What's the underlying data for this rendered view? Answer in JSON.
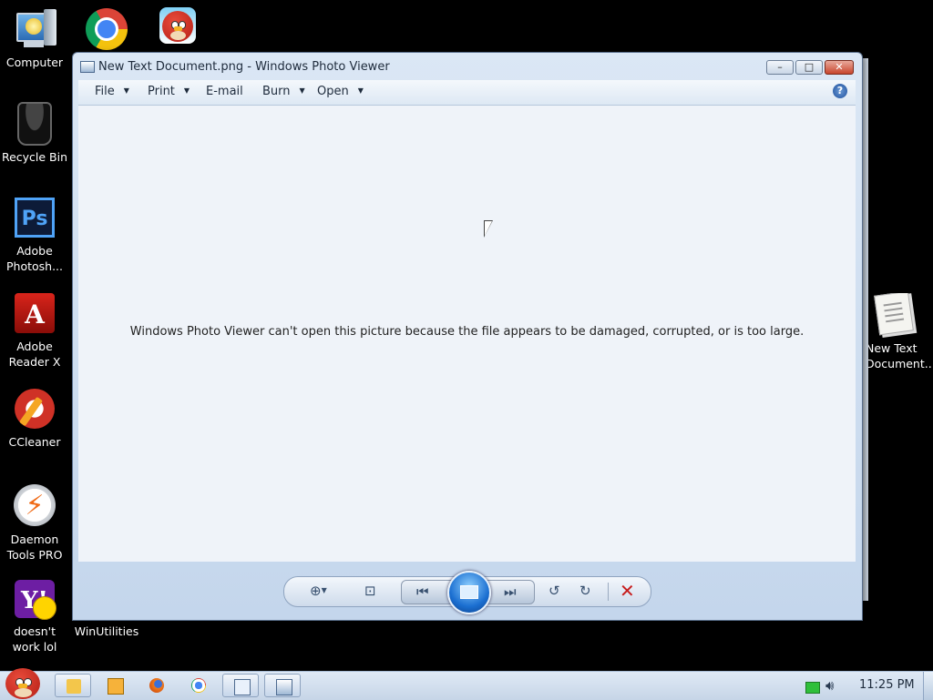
{
  "desktop": {
    "icons": [
      {
        "label": "Computer",
        "icon": "computer-icon"
      },
      {
        "label": "",
        "icon": "chrome-icon"
      },
      {
        "label": "",
        "icon": "angry-birds-icon"
      },
      {
        "label": "Recycle Bin",
        "icon": "recycle-bin-icon"
      },
      {
        "label": "Adobe Photosh...",
        "icon": "photoshop-icon"
      },
      {
        "label": "Adobe Reader X",
        "icon": "acrobat-icon"
      },
      {
        "label": "CCleaner",
        "icon": "ccleaner-icon"
      },
      {
        "label": "Daemon Tools PRO",
        "icon": "daemon-tools-icon"
      },
      {
        "label": "doesn't work lol",
        "icon": "yahoo-messenger-icon"
      },
      {
        "label": "WinUtilities",
        "icon": "winutilities-icon"
      },
      {
        "label": "New Text Document....",
        "icon": "text-document-icon"
      }
    ],
    "ps_glyph": "Ps",
    "yahoo_glyph": "Y!"
  },
  "window": {
    "title": "New Text Document.png - Windows Photo Viewer",
    "controls": {
      "minimize": "–",
      "maximize": "□",
      "close": "✕"
    },
    "menu": [
      {
        "label": "File",
        "has_dropdown": true
      },
      {
        "label": "Print",
        "has_dropdown": true
      },
      {
        "label": "E-mail",
        "has_dropdown": false
      },
      {
        "label": "Burn",
        "has_dropdown": true
      },
      {
        "label": "Open",
        "has_dropdown": true
      }
    ],
    "help_glyph": "?",
    "message": "Windows Photo Viewer can't open this picture because the file appears to be damaged, corrupted, or is too large.",
    "controlbar": {
      "zoom": "zoom-icon",
      "actual_size": "actual-size-icon",
      "previous": "previous-icon",
      "slideshow": "slideshow-icon",
      "next": "next-icon",
      "rotate_ccw": "rotate-counterclockwise-icon",
      "rotate_cw": "rotate-clockwise-icon",
      "delete": "delete-icon"
    }
  },
  "taskbar": {
    "pinned": [
      "explorer-icon",
      "media-player-icon",
      "firefox-icon",
      "chrome-icon",
      "snipping-tool-icon",
      "photo-viewer-icon"
    ],
    "clock": "11:25 PM",
    "dropdown_arrow": "▼"
  },
  "colors": {
    "desktop": "#000000",
    "window_frame": "#c4d6ec",
    "viewer_bg": "#eff3f9",
    "delete_red": "#c71d1d"
  }
}
